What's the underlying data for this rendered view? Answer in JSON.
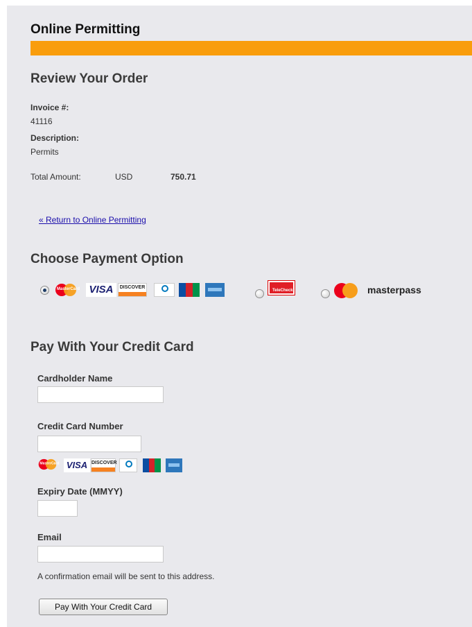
{
  "header": {
    "title": "Online Permitting"
  },
  "review": {
    "title": "Review Your Order",
    "invoice_label": "Invoice #:",
    "invoice_value": "41116",
    "description_label": "Description:",
    "description_value": "Permits",
    "total_label": "Total Amount:",
    "currency": "USD",
    "total_value": "750.71",
    "return_link": "« Return to Online Permitting"
  },
  "payment_options": {
    "title": "Choose Payment Option",
    "options": [
      {
        "name": "credit-card",
        "selected": true,
        "cards": [
          "MasterCard",
          "VISA",
          "DISCOVER",
          "Diners Club",
          "JCB",
          "American Express"
        ]
      },
      {
        "name": "telecheck",
        "selected": false,
        "text": "TeleCheck"
      },
      {
        "name": "masterpass",
        "selected": false,
        "text": "masterpass"
      }
    ]
  },
  "credit_card_form": {
    "title": "Pay With Your Credit Card",
    "cardholder_label": "Cardholder Name",
    "cardholder_value": "",
    "card_number_label": "Credit Card Number",
    "card_number_value": "",
    "expiry_label": "Expiry Date (MMYY)",
    "expiry_value": "",
    "email_label": "Email",
    "email_value": "",
    "email_note": "A confirmation email will be sent to this address.",
    "submit_label": "Pay With Your Credit Card"
  },
  "colors": {
    "accent_bar": "#f99d0c",
    "panel_bg": "#e9e9ed",
    "link": "#1a0dab"
  }
}
